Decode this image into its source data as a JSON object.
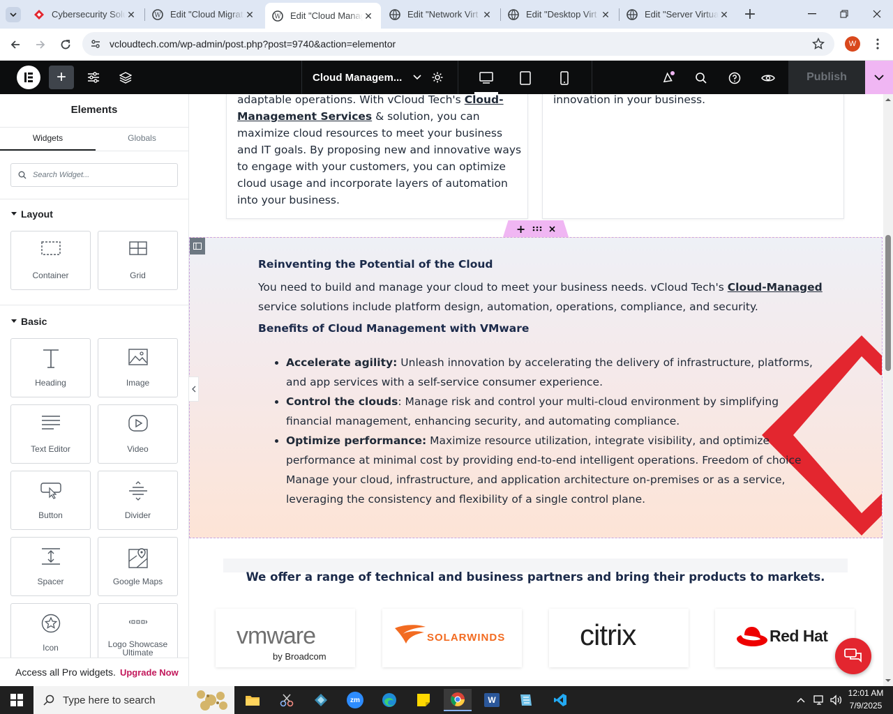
{
  "browser": {
    "tabs": [
      {
        "title": "Cybersecurity Solu",
        "favicon": "red-diamond-icon"
      },
      {
        "title": "Edit \"Cloud Migrat",
        "favicon": "wordpress-icon"
      },
      {
        "title": "Edit \"Cloud Manag",
        "favicon": "wordpress-icon"
      },
      {
        "title": "Edit \"Network Virt",
        "favicon": "globe-icon"
      },
      {
        "title": "Edit \"Desktop Virt",
        "favicon": "globe-icon"
      },
      {
        "title": "Edit \"Server Virtual",
        "favicon": "globe-icon"
      }
    ],
    "url": "vcloudtech.com/wp-admin/post.php?post=9740&action=elementor",
    "profile_initial": "W"
  },
  "editor": {
    "page_title": "Cloud Managem...",
    "publish_label": "Publish"
  },
  "panel": {
    "title": "Elements",
    "tabs": [
      "Widgets",
      "Globals"
    ],
    "search_placeholder": "Search Widget...",
    "layout_label": "Layout",
    "basic_label": "Basic",
    "layout_widgets": [
      "Container",
      "Grid"
    ],
    "basic_widgets": [
      "Heading",
      "Image",
      "Text Editor",
      "Video",
      "Button",
      "Divider",
      "Spacer",
      "Google Maps",
      "Icon",
      "Logo Showcase Ultimate"
    ],
    "promo_text": "Access all Pro widgets.",
    "promo_link": "Upgrade Now"
  },
  "canvas": {
    "top_left_text_1": "adaptable operations. With vCloud Tech's ",
    "top_left_link_1": "Cloud-",
    "top_left_link_2": "Management Services",
    "top_left_text_2": " & solution, you can maximize cloud resources to meet your business and IT goals. By proposing new and innovative ways to engage with your customers, you can optimize cloud usage and incorporate layers of automation into your business.",
    "top_right_text": "innovation in your business.",
    "section_heading": "Reinventing the Potential of the Cloud",
    "intro_text_1": "You need to build and manage your cloud to meet your business needs. vCloud Tech's ",
    "intro_link": "Cloud-Managed",
    "intro_text_2": "service solutions include platform design, automation, operations, compliance, and security.",
    "benefits_heading": "Benefits of Cloud Management with VMware",
    "bullets": [
      {
        "bold": "Accelerate agility:",
        "text": " Unleash innovation by accelerating the delivery of infrastructure, platforms, and app services with a self-service consumer experience."
      },
      {
        "bold": "Control the clouds",
        "text": ": Manage risk and control your multi-cloud environment by simplifying financial management, enhancing security, and automating compliance."
      },
      {
        "bold": "Optimize performance:",
        "text": " Maximize resource utilization, integrate visibility, and optimize performance at minimal cost by providing end-to-end intelligent operations.  Freedom of choice Manage your cloud, infrastructure, and application architecture on-premises or as a service, leveraging the consistency and flexibility of a single control plane."
      }
    ],
    "partners_heading": "We offer a range of technical and business partners and bring their products to markets.",
    "logos": {
      "vmware": "vmware",
      "vmware_sub": "by Broadcom",
      "solarwinds": "SOLARWINDS",
      "citrix": "citrix",
      "redhat": "Red Hat"
    }
  },
  "taskbar": {
    "search_placeholder": "Type here to search",
    "time": "12:01 AM",
    "date": "7/9/2025"
  },
  "colors": {
    "accent_pink": "#f0b6f3",
    "link_dark": "#1f2937",
    "heading_navy": "#1b2a4a",
    "red_chevron": "#e3262f",
    "upgrade_pink": "#c2185b"
  }
}
